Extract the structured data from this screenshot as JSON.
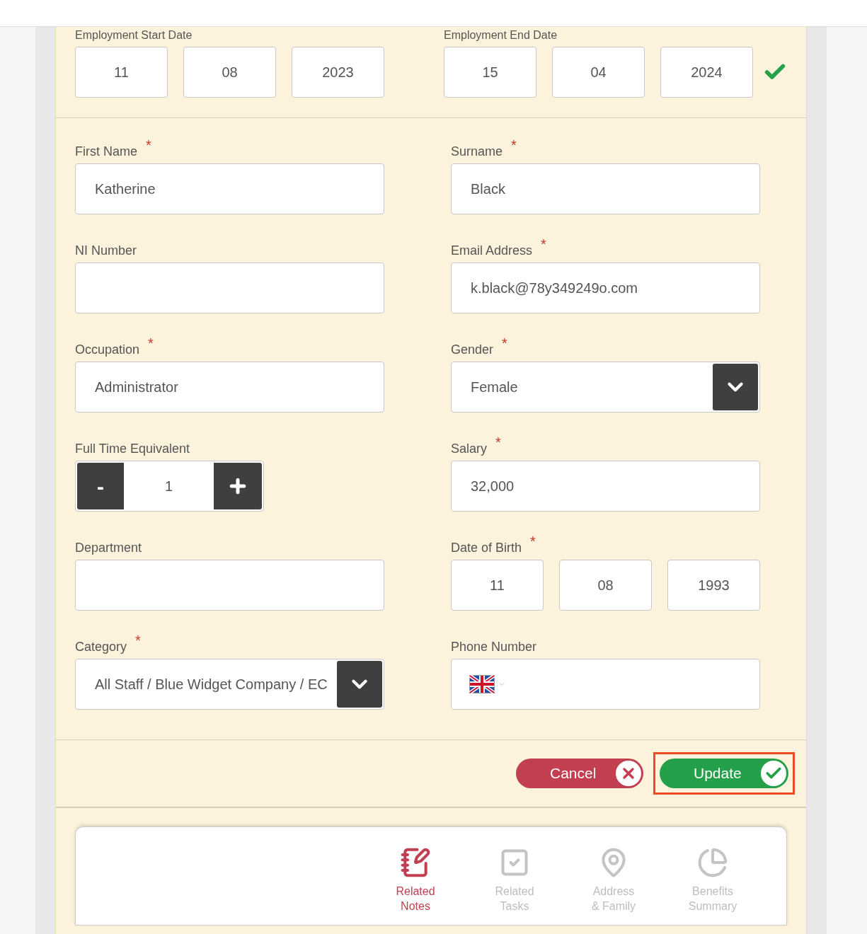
{
  "employment": {
    "start": {
      "label": "Employment Start Date",
      "day": "11",
      "month": "08",
      "year": "2023"
    },
    "end": {
      "label": "Employment End Date",
      "day": "15",
      "month": "04",
      "year": "2024",
      "valid": true
    }
  },
  "fields": [
    {
      "kind": "text",
      "label": "First Name",
      "required": true,
      "value": "Katherine"
    },
    {
      "kind": "text",
      "label": "Surname",
      "required": true,
      "value": "Black"
    },
    {
      "kind": "text",
      "label": "NI Number",
      "required": false
    },
    {
      "kind": "text",
      "label": "Email Address",
      "required": true,
      "value": "k.black@78y349249o.com"
    },
    {
      "kind": "text",
      "label": "Occupation",
      "required": true,
      "value": "Administrator"
    },
    {
      "kind": "select",
      "label": "Gender",
      "required": true,
      "value": "Female"
    },
    {
      "kind": "stepper",
      "label": "Full Time Equivalent",
      "required": false,
      "value": "1",
      "minus": "-"
    },
    {
      "kind": "text",
      "label": "Salary",
      "required": true,
      "value": "32,000"
    },
    {
      "kind": "text",
      "label": "Department",
      "required": false
    },
    {
      "kind": "date",
      "label": "Date of Birth",
      "required": true,
      "day": "11",
      "month": "08",
      "year": "1993"
    },
    {
      "kind": "select",
      "label": "Category",
      "required": true,
      "value": "All Staff / Blue Widget Company / EC"
    },
    {
      "kind": "phone",
      "label": "Phone Number",
      "required": false
    }
  ],
  "required_mark": "*",
  "actions": {
    "cancel": "Cancel",
    "update": "Update",
    "update_highlighted": true
  },
  "tabs": [
    {
      "kind": "notes",
      "lines": [
        "Related",
        "Notes"
      ],
      "selected": true
    },
    {
      "kind": "tasks",
      "lines": [
        "Related",
        "Tasks"
      ],
      "selected": false
    },
    {
      "kind": "address",
      "lines": [
        "Address",
        "& Family"
      ],
      "selected": false
    },
    {
      "kind": "benefits",
      "lines": [
        "Benefits",
        "Summary"
      ],
      "selected": false
    }
  ]
}
